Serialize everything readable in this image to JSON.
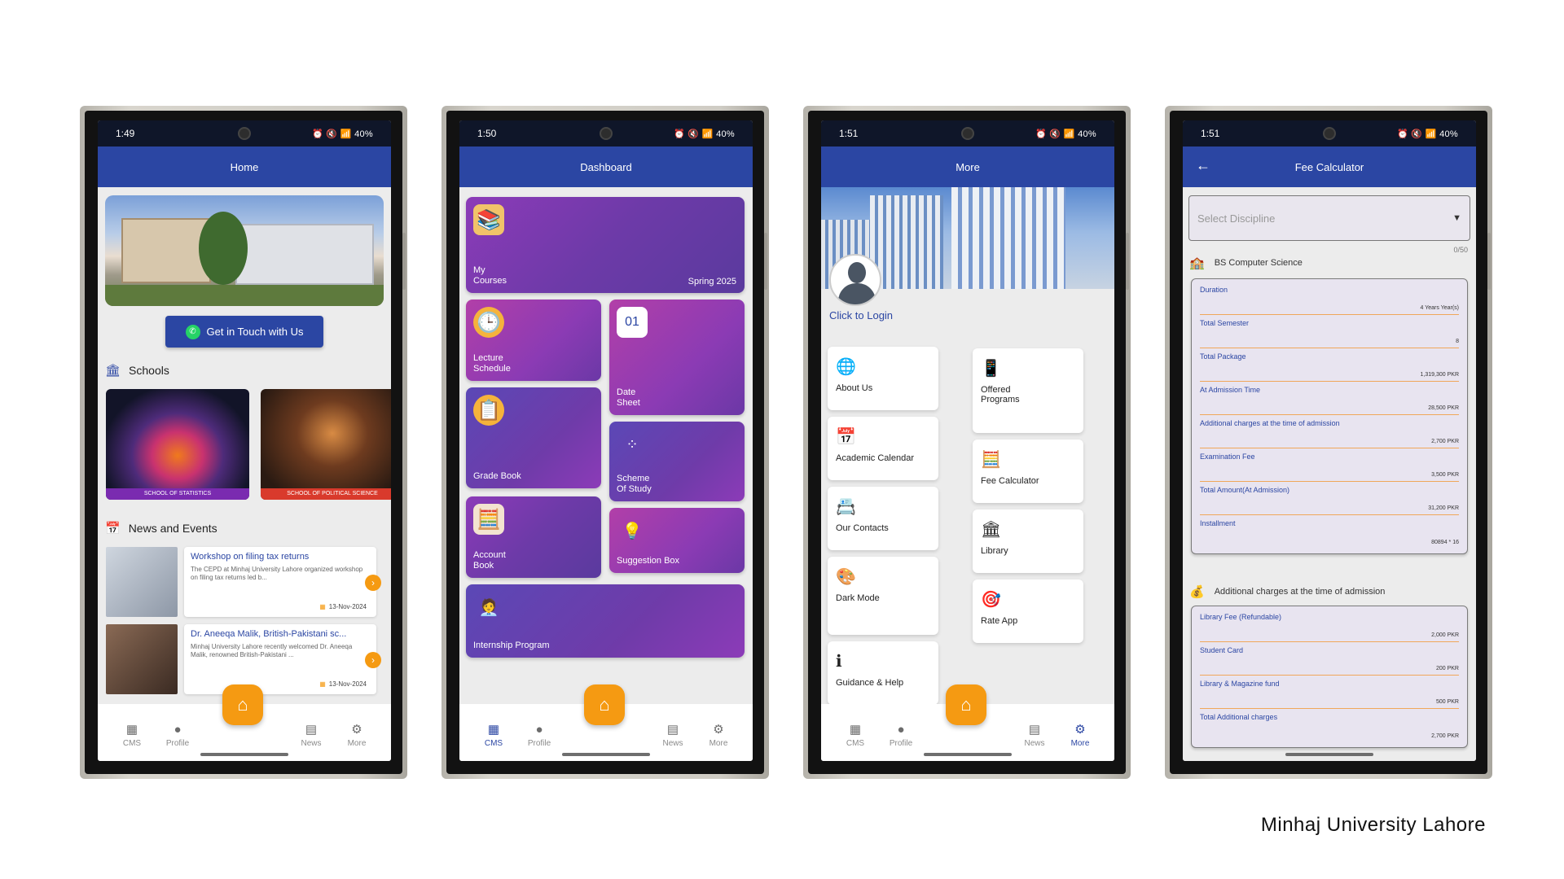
{
  "brand": "Minhaj University Lahore",
  "colors": {
    "primary": "#2b46a3",
    "accent": "#f59a12",
    "tile": "#8c3bb8"
  },
  "status": {
    "s1": {
      "time": "1:49",
      "battery": "40%"
    },
    "s2": {
      "time": "1:50",
      "battery": "40%"
    },
    "s3": {
      "time": "1:51",
      "battery": "40%"
    },
    "s4": {
      "time": "1:51",
      "battery": "40%"
    }
  },
  "nav": {
    "cms": "CMS",
    "profile": "Profile",
    "news": "News",
    "more": "More"
  },
  "home": {
    "title": "Home",
    "whatsapp_btn": "Get in Touch with Us",
    "schools_heading": "Schools",
    "schools": [
      {
        "tag": "SCHOOL OF",
        "name": "STATISTICS"
      },
      {
        "tag": "SCHOOL OF",
        "name": "POLITICAL SCIENCE"
      }
    ],
    "news_heading": "News and Events",
    "news": [
      {
        "title": "Workshop on filing tax returns",
        "body": "The CEPD at Minhaj University Lahore organized workshop on filing tax returns led b...",
        "date": "13-Nov-2024"
      },
      {
        "title": "Dr. Aneeqa Malik, British-Pakistani sc...",
        "body": "Minhaj University Lahore recently welcomed Dr. Aneeqa Malik, renowned British-Pakistani ...",
        "date": "13-Nov-2024"
      }
    ]
  },
  "dashboard": {
    "title": "Dashboard",
    "my_courses": "My\nCourses",
    "semester": "Spring 2025",
    "lecture_schedule": "Lecture\nSchedule",
    "date_sheet": "Date\nSheet",
    "grade_book": "Grade Book",
    "scheme_of_study": "Scheme\nOf Study",
    "account_book": "Account\nBook",
    "suggestion_box": "Suggestion Box",
    "internship": "Internship Program"
  },
  "more": {
    "title": "More",
    "login": "Click to Login",
    "items": {
      "about": "About Us",
      "offered": "Offered\nPrograms",
      "calendar": "Academic Calendar",
      "fee_calc": "Fee Calculator",
      "contacts": "Our Contacts",
      "library": "Library",
      "dark": "Dark Mode",
      "rate": "Rate App",
      "guidance": "Guidance & Help"
    }
  },
  "fee": {
    "title": "Fee Calculator",
    "select_placeholder": "Select Discipline",
    "counter": "0/50",
    "program": "BS Computer Science",
    "rows": [
      {
        "label": "Duration",
        "value": "4 Years Year(s)"
      },
      {
        "label": "Total Semester",
        "value": "8"
      },
      {
        "label": "Total Package",
        "value": "1,319,300 PKR"
      },
      {
        "label": "At Admission Time",
        "value": "28,500 PKR"
      },
      {
        "label": "Additional charges at the time of admission",
        "value": "2,700 PKR"
      },
      {
        "label": "Examination Fee",
        "value": "3,500 PKR"
      },
      {
        "label": "Total Amount(At Admission)",
        "value": "31,200 PKR"
      },
      {
        "label": "Installment",
        "value": "80894 * 16"
      }
    ],
    "additional_heading": "Additional charges at the time of admission",
    "additional_rows": [
      {
        "label": "Library Fee (Refundable)",
        "value": "2,000 PKR"
      },
      {
        "label": "Student Card",
        "value": "200 PKR"
      },
      {
        "label": "Library & Magazine fund",
        "value": "500 PKR"
      },
      {
        "label": "Total Additional charges",
        "value": "2,700 PKR"
      }
    ]
  }
}
